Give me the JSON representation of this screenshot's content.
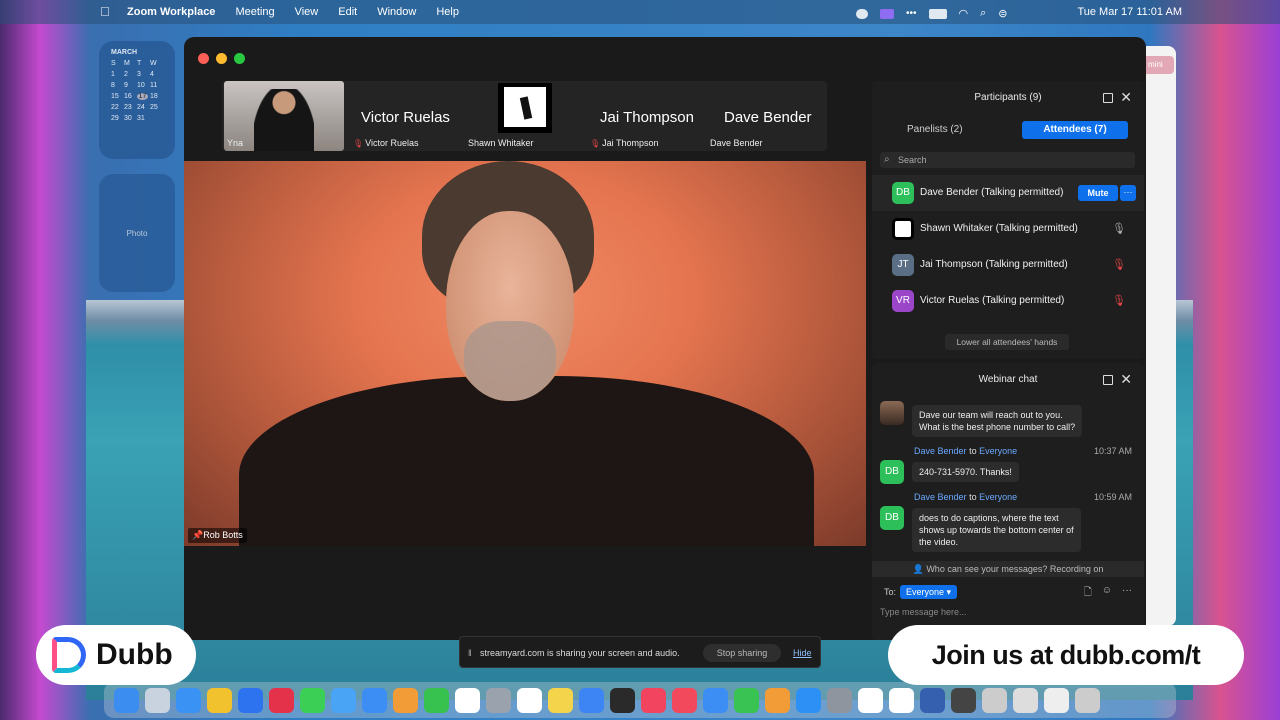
{
  "menubar": {
    "app_name": "Zoom Workplace",
    "menus": [
      "Meeting",
      "View",
      "Edit",
      "Window",
      "Help"
    ],
    "clock": "Tue Mar 17  11:01 AM"
  },
  "calendar_widget": {
    "month": "MARCH",
    "weekdays": [
      "S",
      "M",
      "T",
      "W"
    ],
    "rows": [
      [
        "1",
        "2",
        "3",
        "4"
      ],
      [
        "8",
        "9",
        "10",
        "11"
      ],
      [
        "15",
        "16",
        "17",
        "18"
      ],
      [
        "22",
        "23",
        "24",
        "25"
      ],
      [
        "29",
        "30",
        "31",
        ""
      ]
    ],
    "today": "17"
  },
  "photo_widget": {
    "label": "Photo"
  },
  "behind_window": {
    "tab_label": "mini"
  },
  "gallery": {
    "yna": {
      "label": "Yna"
    },
    "victor": {
      "big": "Victor Ruelas",
      "small": "Victor Ruelas"
    },
    "shawn": {
      "small": "Shawn Whitaker"
    },
    "jai": {
      "big": "Jai Thompson",
      "small": "Jai Thompson"
    },
    "dave": {
      "big": "Dave Bender",
      "small": "Dave Bender"
    }
  },
  "main_video": {
    "name": "Rob Botts"
  },
  "participants": {
    "title": "Participants (9)",
    "tab_panelists": "Panelists (2)",
    "tab_attendees": "Attendees (7)",
    "search_placeholder": "Search",
    "rows": [
      {
        "initials": "DB",
        "name": "Dave Bender (Talking permitted)",
        "color": "#2dbf5a"
      },
      {
        "initials": "",
        "name": "Shawn Whitaker (Talking permitted)",
        "color": "#ffffff"
      },
      {
        "initials": "JT",
        "name": "Jai Thompson (Talking permitted)",
        "color": "#5a6e86"
      },
      {
        "initials": "VR",
        "name": "Victor Ruelas (Talking permitted)",
        "color": "#9b45c9"
      }
    ],
    "mute_label": "Mute",
    "more_label": "···",
    "lower_hands": "Lower all attendees' hands"
  },
  "chat": {
    "title": "Webinar chat",
    "messages": [
      {
        "text1": "Dave our team will reach out to you.",
        "text2": "What is the best phone number to call?"
      },
      {
        "initials": "DB",
        "sender": "Dave Bender",
        "to": "to",
        "recipient": "Everyone",
        "time": "10:37 AM",
        "text1": "240-731-5970. Thanks!"
      },
      {
        "initials": "DB",
        "sender": "Dave Bender",
        "to": "to",
        "recipient": "Everyone",
        "time": "10:59 AM",
        "text1": "does to do captions, where the text",
        "text2": "shows up towards the bottom center of",
        "text3": "the video."
      }
    ],
    "privacy_note": "Who can see your messages? Recording on",
    "to_label": "To:",
    "to_value": "Everyone ▾",
    "input_placeholder": "Type message here..."
  },
  "sharebar": {
    "message": "streamyard.com is sharing your screen and audio.",
    "stop": "Stop sharing",
    "hide": "Hide"
  },
  "overlay": {
    "logo": "Dubb",
    "cta": "Join us at dubb.com/t"
  },
  "dock_colors": [
    "#3b8df0",
    "#c9d3df",
    "#3a92f5",
    "#f2c12e",
    "#2d73f0",
    "#e4324a",
    "#3ccf55",
    "#49a4f5",
    "#3c8ef5",
    "#f29c38",
    "#37c24f",
    "#ffffff",
    "#9aa3ad",
    "#ffffff",
    "#f4d44a",
    "#3d84f5",
    "#2a2a2a",
    "#f2445e",
    "#f24a5c",
    "#3c8ef5",
    "#38c353",
    "#f29c38",
    "#2c90f5",
    "#8e959e",
    "#ffffff",
    "#ffffff",
    "#3560b0",
    "#444444",
    "#cccccc",
    "#dddddd",
    "#eeeeee",
    "#cccccc"
  ]
}
